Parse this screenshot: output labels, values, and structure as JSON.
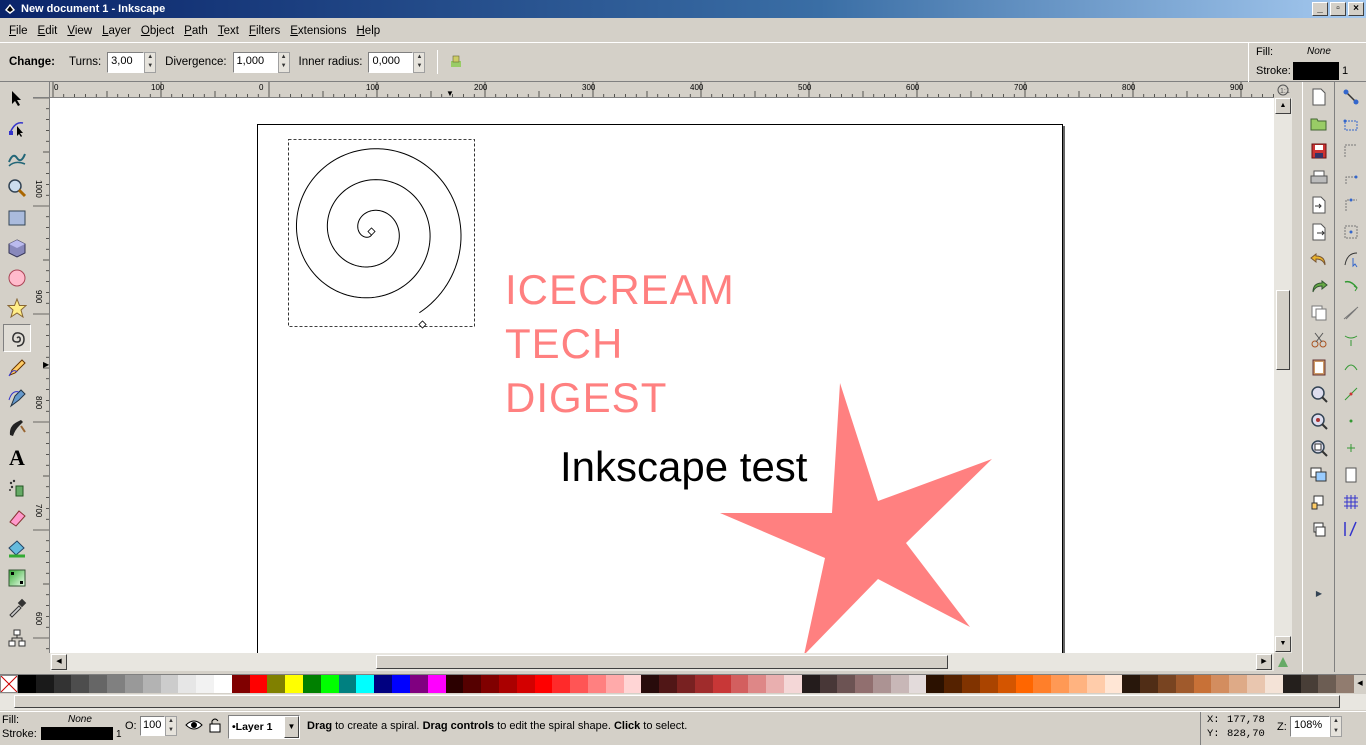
{
  "window": {
    "title": "New document 1 - Inkscape"
  },
  "menu": [
    "File",
    "Edit",
    "View",
    "Layer",
    "Object",
    "Path",
    "Text",
    "Filters",
    "Extensions",
    "Help"
  ],
  "controls": {
    "change_label": "Change:",
    "turns_label": "Turns:",
    "turns_value": "3,00",
    "divergence_label": "Divergence:",
    "divergence_value": "1,000",
    "inner_radius_label": "Inner radius:",
    "inner_radius_value": "0,000"
  },
  "style_indicator": {
    "fill_label": "Fill:",
    "fill_value": "None",
    "stroke_label": "Stroke:",
    "stroke_width": "1"
  },
  "ruler": {
    "h_labels": [
      "0",
      "100",
      "200",
      "300",
      "400",
      "500",
      "600",
      "700",
      "800",
      "900"
    ],
    "v_labels": [
      "1000",
      "900",
      "800",
      "700",
      "600"
    ]
  },
  "canvas": {
    "text_lines": [
      "ICECREAM",
      "TECH",
      "DIGEST"
    ],
    "text_color": "#ff8080",
    "test_text": "Inkscape test",
    "star_color": "#ff8080"
  },
  "palette": [
    "#000000",
    "#1a1a1a",
    "#333333",
    "#4d4d4d",
    "#666666",
    "#808080",
    "#999999",
    "#b3b3b3",
    "#cccccc",
    "#e6e6e6",
    "#f2f2f2",
    "#ffffff",
    "#800000",
    "#ff0000",
    "#808000",
    "#ffff00",
    "#008000",
    "#00ff00",
    "#008080",
    "#00ffff",
    "#000080",
    "#0000ff",
    "#800080",
    "#ff00ff",
    "#2b0000",
    "#550000",
    "#800000",
    "#aa0000",
    "#d40000",
    "#ff0000",
    "#ff2a2a",
    "#ff5555",
    "#ff8080",
    "#ffaaaa",
    "#ffd5d5",
    "#280b0b",
    "#501616",
    "#782121",
    "#a02c2c",
    "#c83737",
    "#d35f5f",
    "#de8787",
    "#e9afaf",
    "#f4d7d7",
    "#241c1c",
    "#483737",
    "#6c5353",
    "#916f6f",
    "#ac9393",
    "#c8b7b7",
    "#e3dbdb",
    "#2b1100",
    "#552200",
    "#803300",
    "#aa4400",
    "#d45500",
    "#ff6600",
    "#ff7f2a",
    "#ff9955",
    "#ffb380",
    "#ffccaa",
    "#ffe6d5",
    "#28170b",
    "#502d16",
    "#784421",
    "#a05a2c",
    "#c87137",
    "#d38d5f",
    "#deaa87",
    "#e9c6af",
    "#f4e3d7",
    "#241f1c",
    "#483e37",
    "#6c5d53",
    "#917c6f"
  ],
  "status": {
    "fill_label": "Fill:",
    "fill_value": "None",
    "stroke_label": "Stroke:",
    "stroke_width": "1",
    "opacity_label": "O:",
    "opacity_value": "100",
    "layer": "•Layer 1",
    "msg_1": "Drag",
    "msg_2": " to create a spiral. ",
    "msg_3": "Drag controls",
    "msg_4": " to edit the spiral shape. ",
    "msg_5": "Click",
    "msg_6": " to select.",
    "x_label": "X:",
    "x_value": "177,78",
    "y_label": "Y:",
    "y_value": "828,70",
    "zoom_label": "Z:",
    "zoom_value": "108%"
  }
}
